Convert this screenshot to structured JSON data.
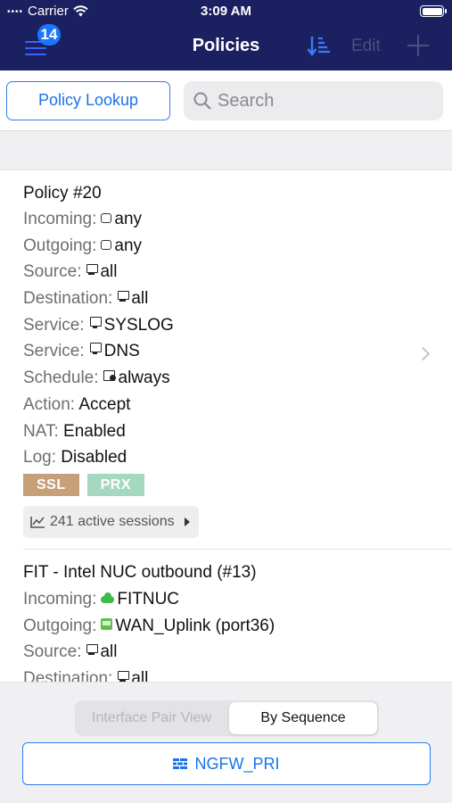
{
  "status": {
    "carrier": "Carrier",
    "time": "3:09 AM"
  },
  "nav": {
    "title": "Policies",
    "badge": "14",
    "edit_label": "Edit"
  },
  "toolbar": {
    "lookup_label": "Policy Lookup",
    "search_placeholder": "Search"
  },
  "policies": [
    {
      "title": "Policy #20",
      "rows": [
        {
          "label": "Incoming:",
          "value": "any",
          "icon": "interface-icon"
        },
        {
          "label": "Outgoing:",
          "value": "any",
          "icon": "interface-icon"
        },
        {
          "label": "Source:",
          "value": "all",
          "icon": "address-icon"
        },
        {
          "label": "Destination:",
          "value": "all",
          "icon": "address-icon"
        },
        {
          "label": "Service:",
          "value": "SYSLOG",
          "icon": "service-icon"
        },
        {
          "label": "Service:",
          "value": "DNS",
          "icon": "service-icon"
        },
        {
          "label": "Schedule:",
          "value": "always",
          "icon": "schedule-icon"
        },
        {
          "label": "Action:",
          "value": "Accept"
        },
        {
          "label": "NAT:",
          "value": "Enabled"
        },
        {
          "label": "Log:",
          "value": "Disabled"
        }
      ],
      "tags": [
        {
          "label": "SSL",
          "color": "#c5a079"
        },
        {
          "label": "PRX",
          "color": "#a5d8c0"
        }
      ],
      "sessions": "241 active sessions"
    },
    {
      "title": "FIT - Intel NUC outbound (#13)",
      "rows": [
        {
          "label": "Incoming:",
          "value": "FITNUC",
          "icon": "cloud-icon"
        },
        {
          "label": "Outgoing:",
          "value": "WAN_Uplink (port36)",
          "icon": "wan-icon"
        },
        {
          "label": "Source:",
          "value": "all",
          "icon": "address-icon"
        },
        {
          "label": "Destination:",
          "value": "all",
          "icon": "address-icon"
        }
      ]
    }
  ],
  "bottom": {
    "segments": [
      "Interface Pair View",
      "By Sequence"
    ],
    "selected_segment": "By Sequence",
    "device": "NGFW_PRI"
  },
  "colors": {
    "header_bg": "#1b2160",
    "accent": "#1a73e8",
    "badge": "#1c74ff"
  }
}
